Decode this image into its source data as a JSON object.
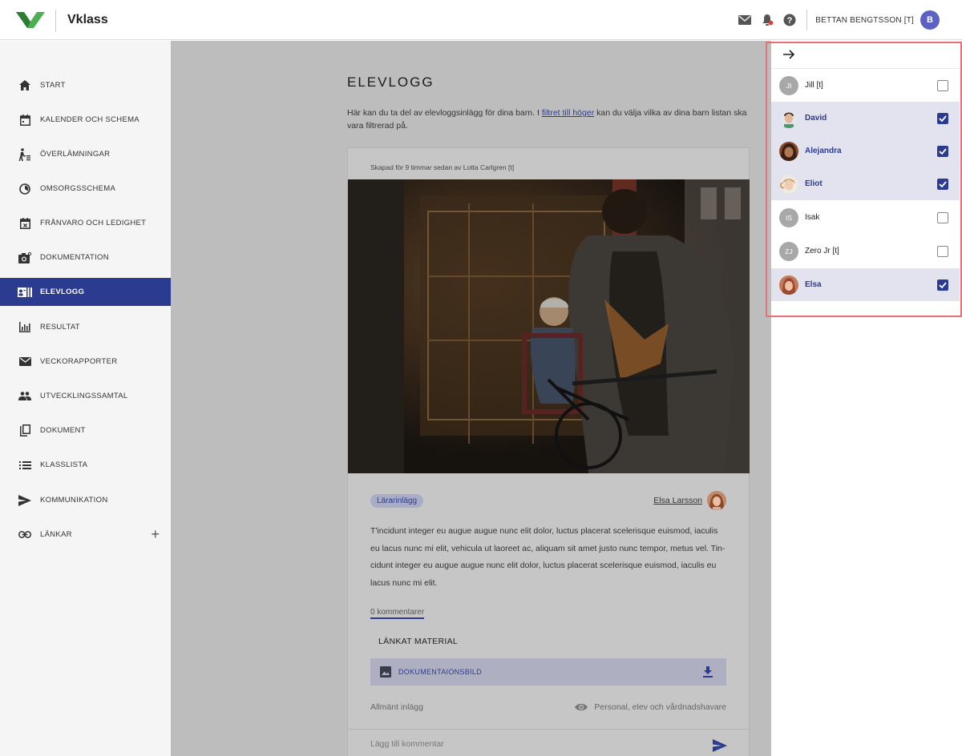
{
  "header": {
    "brand": "Vklass",
    "user_name": "BETTAN BENGTSSON [T]",
    "user_initial": "B",
    "icons": [
      "mail-icon",
      "bell-icon",
      "help-icon"
    ],
    "accent_color": "#2b3b8f",
    "notification_dot_color": "#e53935"
  },
  "sidebar": {
    "items": [
      {
        "label": "START",
        "icon": "home-icon"
      },
      {
        "label": "KALENDER OCH SCHEMA",
        "icon": "calendar-icon"
      },
      {
        "label": "ÖVERLÄMNINGAR",
        "icon": "handover-icon"
      },
      {
        "label": "OMSORGSSCHEMA",
        "icon": "clock-icon"
      },
      {
        "label": "FRÅNVARO OCH LEDIGHET",
        "icon": "calendar-x-icon"
      },
      {
        "label": "DOKUMENTATION",
        "icon": "camera-icon"
      },
      {
        "label": "ELEVLOGG",
        "icon": "log-icon",
        "active": true
      },
      {
        "label": "RESULTAT",
        "icon": "chart-icon"
      },
      {
        "label": "VECKORAPPORTER",
        "icon": "mail-icon"
      },
      {
        "label": "UTVECKLINGSSAMTAL",
        "icon": "people-icon"
      },
      {
        "label": "DOKUMENT",
        "icon": "copy-icon"
      },
      {
        "label": "KLASSLISTA",
        "icon": "list-icon"
      },
      {
        "label": "KOMMUNIKATION",
        "icon": "send-icon"
      },
      {
        "label": "LÄNKAR",
        "icon": "link-icon",
        "plus": "+"
      }
    ]
  },
  "main": {
    "title": "ELEVLOGG",
    "intro_before": "Här kan du ta del av elevloggsinlägg för dina barn. I ",
    "intro_link": "filtret till höger",
    "intro_after": " kan du välja vilka av dina barn listan ska vara filtrerad på.",
    "post": {
      "meta": "Skapad för 9 timmar sedan av Lotta Carlgren [t]",
      "badge": "Lärarinlägg",
      "author": "Elsa Larsson",
      "body": "T'incidunt integer eu augue augue nunc elit dolor, luctus placerat scelerisque euismod, iaculis eu lacus nunc mi elit, vehicula ut laoreet ac, aliquam sit amet justo nunc tempor, metus vel. Tin- cidunt integer eu augue augue nunc elit dolor, luctus placerat scelerisque euismod, iaculis eu lacus nunc mi elit.",
      "comments": "0 kommentarer",
      "linked_title": "LÄNKAT MATERIAL",
      "attachment": "DOKUMENTAIONSBILD",
      "post_type": "Allmänt inlägg",
      "visibility": "Personal, elev och vårdnadshavare",
      "comment_placeholder": "Lägg till kommentar"
    }
  },
  "filter": {
    "children": [
      {
        "name": "Jill [t]",
        "initials": "JI",
        "checked": false,
        "photo": false
      },
      {
        "name": "David",
        "initials": "",
        "checked": true,
        "photo": true
      },
      {
        "name": "Alejandra",
        "initials": "",
        "checked": true,
        "photo": true
      },
      {
        "name": "Eliot",
        "initials": "",
        "checked": true,
        "photo": true
      },
      {
        "name": "Isak",
        "initials": "IS",
        "checked": false,
        "photo": false
      },
      {
        "name": "Zero Jr [t]",
        "initials": "ZJ",
        "checked": false,
        "photo": false
      },
      {
        "name": "Elsa",
        "initials": "",
        "checked": true,
        "photo": true
      }
    ]
  }
}
